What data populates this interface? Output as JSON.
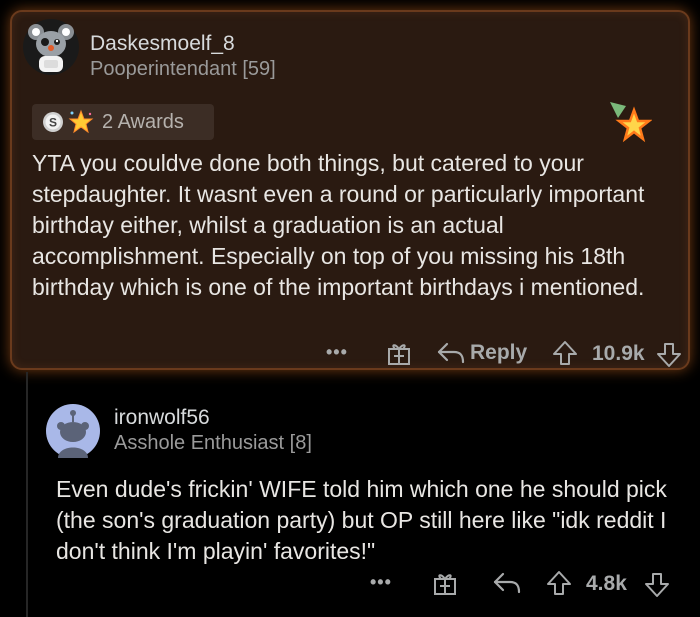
{
  "comment": {
    "username": "Daskesmoelf_8",
    "flair": "Pooperintendant [59]",
    "awards_label": "2 Awards",
    "body": "YTA you couldve done both things, but catered to your stepdaughter. It wasnt even a round or particularly important birthday either, whilst a graduation is an actual accomplishment. Especially on top of you missing his 18th birthday which is one of the important birthdays i mentioned.",
    "more": "•••",
    "reply_label": "Reply",
    "score": "10.9k",
    "accent_color": "#ff8a2a"
  },
  "reply": {
    "username": "ironwolf56",
    "flair": "Asshole Enthusiast [8]",
    "body": "Even dude's frickin' WIFE told him which one he should pick (the son's graduation party) but OP still here like \"idk reddit I don't think I'm playin' favorites!\"",
    "more": "•••",
    "score": "4.8k"
  },
  "icons": [
    "more-icon",
    "gift-award-icon",
    "reply-arrow-icon",
    "upvote-icon",
    "downvote-icon",
    "silver-award-icon",
    "star-award-icon"
  ]
}
